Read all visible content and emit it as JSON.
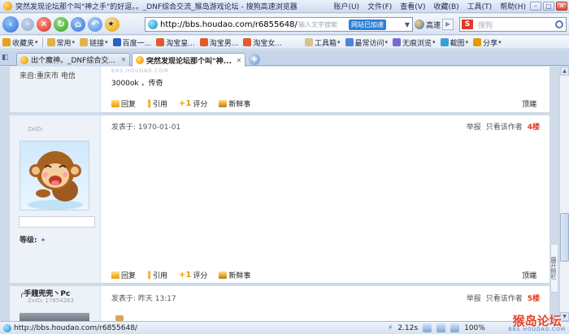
{
  "window": {
    "title": "突然发现论坛那个叫\"神之手\"的好逗。。_DNF综合交流_猴岛游戏论坛 - 搜狗高速浏览器",
    "menu": [
      "账户(U)",
      "文件(F)",
      "查看(V)",
      "收藏(B)",
      "工具(T)",
      "帮助(H)"
    ],
    "buttons": {
      "minimize": "–",
      "maximize": "□",
      "close": "✕"
    }
  },
  "navbar": {
    "url": "http://bbs.houdao.com/r6855648/",
    "addr_hint": "输入文字搜索",
    "accel_label": "网站已加速",
    "speed_label": "高速",
    "search_placeholder": "搜狗"
  },
  "favorites": [
    {
      "label": "收藏夹",
      "color": "#e3a21a",
      "caret": true
    },
    {
      "label": "常用",
      "color": "#e3b14a",
      "caret": true
    },
    {
      "label": "链接",
      "color": "#e3b14a",
      "caret": true
    },
    {
      "label": "百度一...",
      "color": "#2b60c8",
      "caret": false
    },
    {
      "label": "淘宝皇...",
      "color": "#e35a2a",
      "caret": false
    },
    {
      "label": "淘宝男...",
      "color": "#e35a2a",
      "caret": false
    },
    {
      "label": "淘宝女...",
      "color": "#e35a2a",
      "caret": false
    },
    {
      "label": "工具箱",
      "color": "#d9c28a",
      "caret": true
    },
    {
      "label": "最常访问",
      "color": "#4c86d8",
      "caret": true
    },
    {
      "label": "无痕浏览",
      "color": "#7a6ad0",
      "caret": true
    },
    {
      "label": "截图",
      "color": "#3b9fd8",
      "caret": true
    },
    {
      "label": "分享",
      "color": "#e79a06",
      "caret": true
    }
  ],
  "tabs": [
    {
      "label": "出个魔神。_DNF综合交...",
      "active": false
    },
    {
      "label": "突然发现论坛那个叫\"神...",
      "active": true
    }
  ],
  "posts": [
    {
      "from_label": "来自:重庆市 电信",
      "text": "3000ok ，传奇",
      "actions": [
        "回复",
        "引用",
        "评分",
        "新鲜事"
      ],
      "top": "顶端"
    },
    {
      "user_name": "",
      "user_id": "ZxiD₁",
      "time": "发表于: 1970-01-01",
      "report": "举报",
      "only_author": "只看该作者",
      "floor": "4楼",
      "level_label": "等级:",
      "level_mark": "✦",
      "actions": [
        "回复",
        "引用",
        "评分",
        "新鲜事"
      ],
      "top": "顶端"
    },
    {
      "user_name": "╭手賤兜兜丶Pc",
      "user_id": "ZxiD₁    17854263",
      "time": "发表于: 昨天 13:17",
      "report": "举报",
      "only_author": "只看该作者",
      "floor": "5楼"
    }
  ],
  "sidebar_tab": "展开侧栏",
  "statusbar": {
    "url": "http://bbs.houdao.com/r6855648/",
    "speed": "2.12s",
    "zoom": "100%"
  },
  "watermark": {
    "cn": "猴岛论坛",
    "en": "BBS.HOUDAO.COM"
  },
  "wm_text": "BBS.HOUDAO.COM"
}
